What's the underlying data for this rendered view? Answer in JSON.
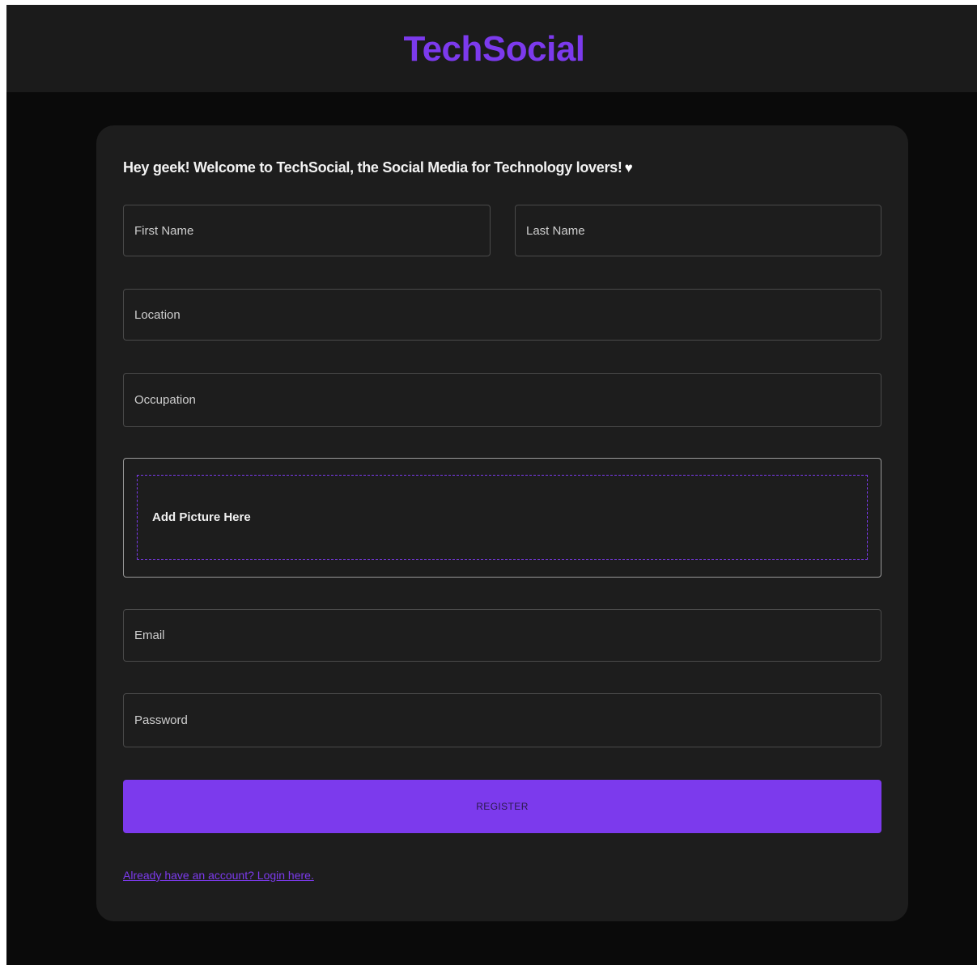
{
  "header": {
    "brand": "TechSocial"
  },
  "form": {
    "welcome": "Hey geek! Welcome to TechSocial, the Social Media for Technology lovers!",
    "heart_glyph": "♥",
    "first_name": {
      "placeholder": "First Name",
      "value": ""
    },
    "last_name": {
      "placeholder": "Last Name",
      "value": ""
    },
    "location": {
      "placeholder": "Location",
      "value": ""
    },
    "occupation": {
      "placeholder": "Occupation",
      "value": ""
    },
    "picture_label": "Add Picture Here",
    "email": {
      "placeholder": "Email",
      "value": ""
    },
    "password": {
      "placeholder": "Password",
      "value": ""
    },
    "register_label": "REGISTER",
    "login_link": "Already have an account? Login here."
  },
  "colors": {
    "accent": "#7c3aed",
    "page_background": "#0a0a0a",
    "header_background": "#1b1b1b",
    "card_background": "#1d1d1d"
  }
}
